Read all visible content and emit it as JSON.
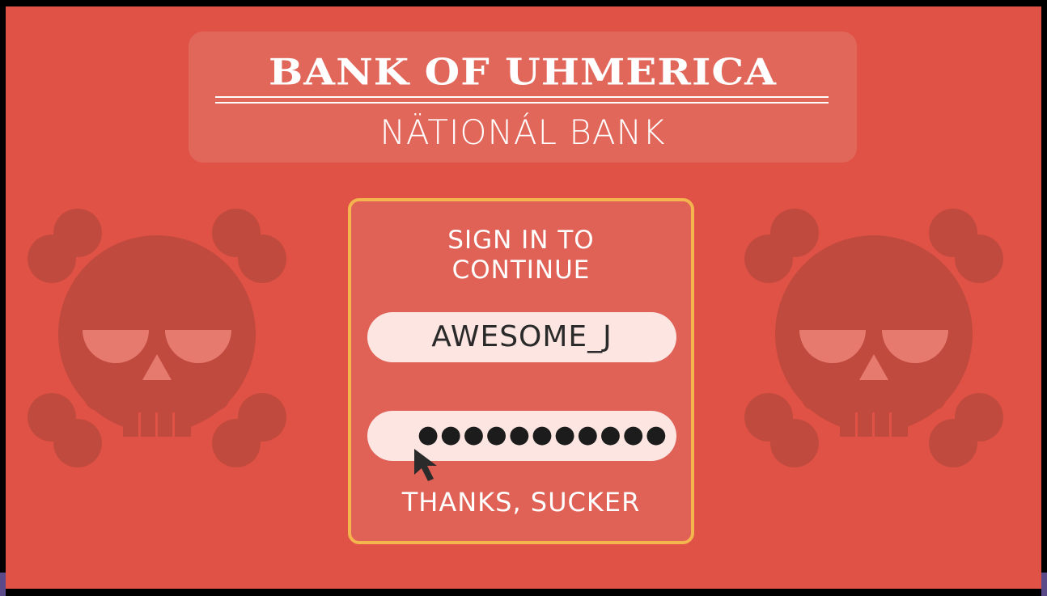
{
  "header": {
    "bank_name": "BANK OF UHMERICA",
    "bank_subtitle": "NÄTIONÁL BANK"
  },
  "login": {
    "title_line1": "SIGN IN TO",
    "title_line2": "CONTINUE",
    "username_value": "AWESOME_J",
    "password_mask": "●●●●●●●●●●●",
    "footer": "THANKS, SUCKER"
  },
  "icons": {
    "left_decoration": "skull-crossbones-icon",
    "right_decoration": "skull-crossbones-icon",
    "pointer": "mouse-cursor-icon"
  },
  "colors": {
    "background": "#df5245",
    "card_border": "#f4b44e",
    "field_fill": "#fde6e1",
    "skull": "#c14a3e"
  }
}
